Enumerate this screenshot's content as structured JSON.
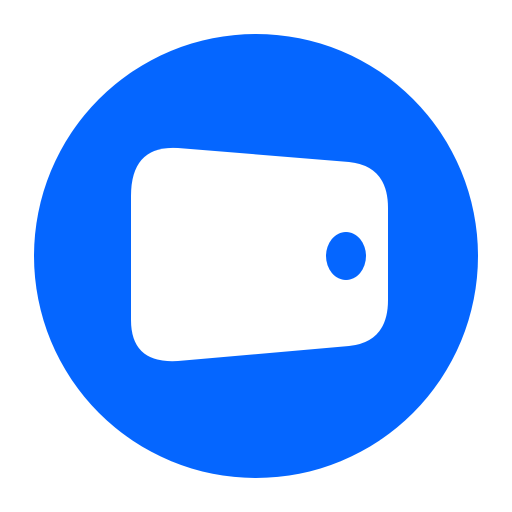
{
  "icon": {
    "name": "wallet-icon",
    "colors": {
      "background": "#ffffff",
      "circle": "#0566ff",
      "wallet": "#ffffff",
      "clasp": "#0566ff"
    }
  }
}
